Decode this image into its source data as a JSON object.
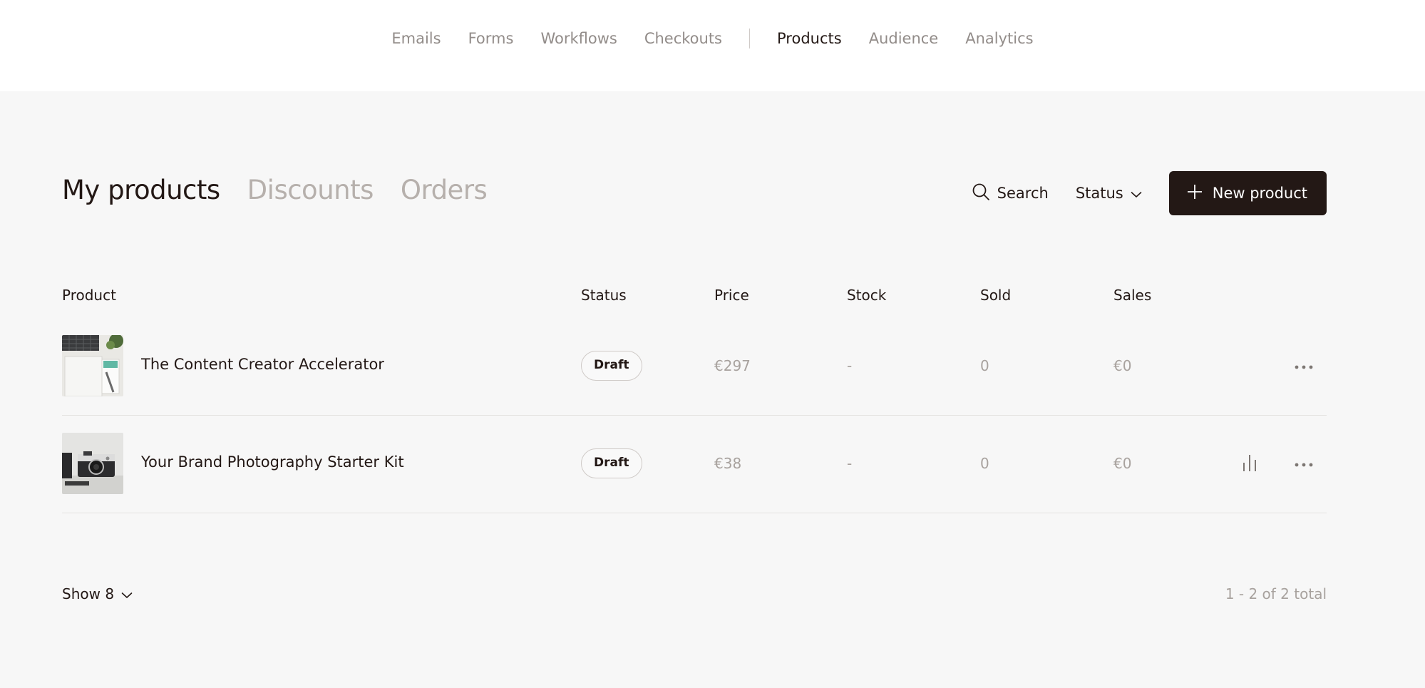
{
  "topnav": {
    "items": [
      {
        "label": "Emails"
      },
      {
        "label": "Forms"
      },
      {
        "label": "Workflows"
      },
      {
        "label": "Checkouts"
      },
      {
        "label": "Products"
      },
      {
        "label": "Audience"
      },
      {
        "label": "Analytics"
      }
    ],
    "active": "Products"
  },
  "tabs": [
    {
      "label": "My products"
    },
    {
      "label": "Discounts"
    },
    {
      "label": "Orders"
    }
  ],
  "actions": {
    "search_label": "Search",
    "status_label": "Status",
    "new_label": "New product"
  },
  "table": {
    "columns": [
      "Product",
      "Status",
      "Price",
      "Stock",
      "Sold",
      "Sales"
    ],
    "rows": [
      {
        "name": "The Content Creator Accelerator",
        "status": "Draft",
        "price": "€297",
        "stock": "-",
        "sold": "0",
        "sales": "€0",
        "has_analytics": false
      },
      {
        "name": "Your Brand Photography Starter Kit",
        "status": "Draft",
        "price": "€38",
        "stock": "-",
        "sold": "0",
        "sales": "€0",
        "has_analytics": true
      }
    ]
  },
  "footer": {
    "show_label": "Show 8",
    "total_label": "1 - 2 of 2 total"
  },
  "colors": {
    "primary": "#231815",
    "muted": "#b6b0ac",
    "background": "#f7f7f7"
  }
}
